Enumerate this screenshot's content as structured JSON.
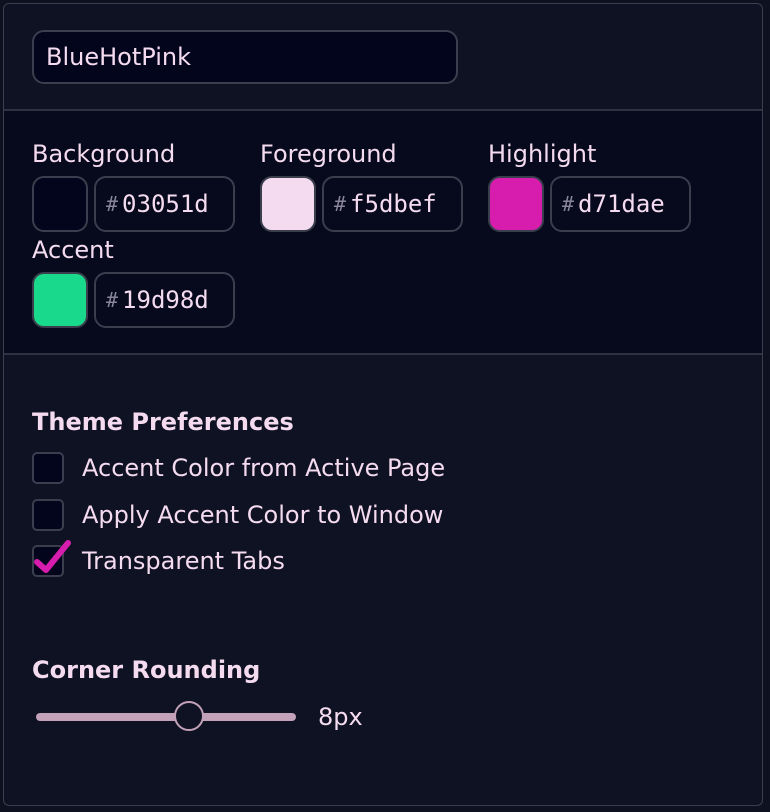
{
  "theme": {
    "name": "BlueHotPink"
  },
  "colors": [
    {
      "label": "Background",
      "hash": "#",
      "value": "03051d",
      "swatch": "#03051d"
    },
    {
      "label": "Foreground",
      "hash": "#",
      "value": "f5dbef",
      "swatch": "#f5dbef"
    },
    {
      "label": "Highlight",
      "hash": "#",
      "value": "d71dae",
      "swatch": "#d71dae"
    },
    {
      "label": "Accent",
      "hash": "#",
      "value": "19d98d",
      "swatch": "#19d98d"
    }
  ],
  "preferences": {
    "title": "Theme Preferences",
    "items": [
      {
        "label": "Accent Color from Active Page",
        "checked": false
      },
      {
        "label": "Apply Accent Color to Window",
        "checked": false
      },
      {
        "label": "Transparent Tabs",
        "checked": true
      }
    ]
  },
  "rounding": {
    "title": "Corner Rounding",
    "value_label": "8px",
    "fraction": 0.59
  },
  "accent_colors": {
    "check": "#d71dae",
    "border": "#3a3e4d"
  },
  "icons": {
    "check": "checkmark-icon"
  }
}
